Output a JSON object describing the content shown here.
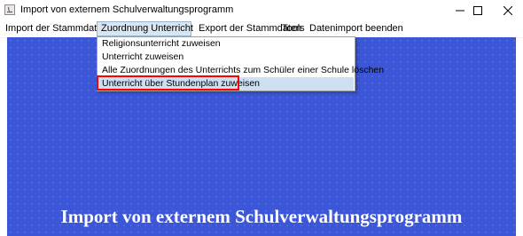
{
  "window": {
    "title": "Import von externem Schulverwaltungsprogramm",
    "icons": {
      "app": "java-app-icon",
      "minimize": "minimize-icon",
      "maximize": "maximize-icon",
      "close": "close-icon"
    }
  },
  "menubar": {
    "items": [
      {
        "label": "Import der Stammdaten"
      },
      {
        "label": "Zuordnung Unterricht"
      },
      {
        "label": "Export der Stammdaten"
      },
      {
        "label": "Tools"
      },
      {
        "label": "Datenimport beenden"
      }
    ],
    "active_index": 1
  },
  "dropdown": {
    "items": [
      {
        "label": "Religionsunterricht zuweisen"
      },
      {
        "label": "Unterricht zuweisen"
      },
      {
        "label": "Alle Zuordnungen des Unterrichts zum Schüler einer Schule löschen"
      },
      {
        "label": "Unterricht über Stundenplan zuweisen"
      }
    ],
    "highlighted_index": 3,
    "annotation_color": "#ff0000"
  },
  "content": {
    "heading": "Import von externem Schulverwaltungsprogramm",
    "background_color": "#3b56d6"
  }
}
